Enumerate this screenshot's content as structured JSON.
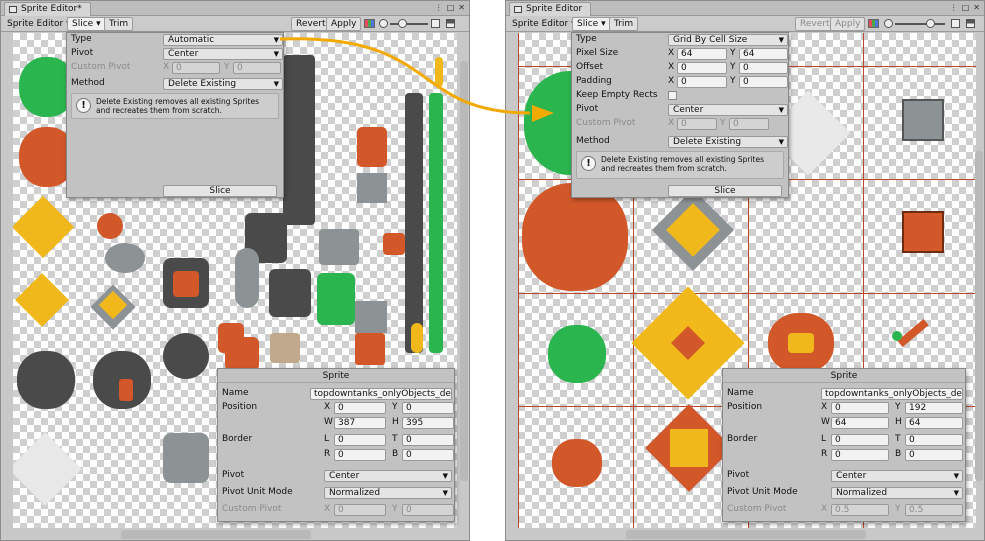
{
  "colors": {
    "window_bg": "#c8c8c8",
    "grid_line": "#b9482f",
    "arrow": "#f2a900",
    "sprite_green": "#2bb54f",
    "sprite_orange": "#d2582a",
    "sprite_yellow": "#f0b81b",
    "sprite_grey": "#8d9395"
  },
  "left": {
    "tab_title": "Sprite Editor*",
    "toolbar": {
      "mode": "Sprite Editor",
      "slice": "Slice",
      "trim": "Trim",
      "revert": "Revert",
      "apply": "Apply"
    },
    "slice_panel": {
      "type_label": "Type",
      "type_value": "Automatic",
      "pivot_label": "Pivot",
      "pivot_value": "Center",
      "custom_pivot_label": "Custom Pivot",
      "x_label": "X",
      "x_value": "0",
      "y_label": "Y",
      "y_value": "0",
      "method_label": "Method",
      "method_value": "Delete Existing",
      "help_text": "Delete Existing removes all existing Sprites and recreates them from scratch.",
      "slice_button": "Slice"
    },
    "sprite_panel": {
      "title": "Sprite",
      "name_label": "Name",
      "name_value": "topdowntanks_onlyObjects_de",
      "position_label": "Position",
      "x_label": "X",
      "x_value": "0",
      "y_label": "Y",
      "y_value": "0",
      "w_label": "W",
      "w_value": "387",
      "h_label": "H",
      "h_value": "395",
      "border_label": "Border",
      "l_label": "L",
      "l_value": "0",
      "t_label": "T",
      "t_value": "0",
      "r_label": "R",
      "r_value": "0",
      "b_label": "B",
      "b_value": "0",
      "pivot_label": "Pivot",
      "pivot_value": "Center",
      "pivot_unit_label": "Pivot Unit Mode",
      "pivot_unit_value": "Normalized",
      "custom_pivot_label": "Custom Pivot",
      "cx_value": "0",
      "cy_value": "0"
    }
  },
  "right": {
    "tab_title": "Sprite Editor",
    "toolbar": {
      "mode": "Sprite Editor",
      "slice": "Slice",
      "trim": "Trim",
      "revert": "Revert",
      "apply": "Apply"
    },
    "slice_panel": {
      "type_label": "Type",
      "type_value": "Grid By Cell Size",
      "pixel_size_label": "Pixel Size",
      "px_x": "64",
      "px_y": "64",
      "offset_label": "Offset",
      "off_x": "0",
      "off_y": "0",
      "padding_label": "Padding",
      "pad_x": "0",
      "pad_y": "0",
      "keep_empty_label": "Keep Empty Rects",
      "pivot_label": "Pivot",
      "pivot_value": "Center",
      "custom_pivot_label": "Custom Pivot",
      "cp_x": "0",
      "cp_y": "0",
      "method_label": "Method",
      "method_value": "Delete Existing",
      "help_text": "Delete Existing removes all existing Sprites and recreates them from scratch.",
      "slice_button": "Slice",
      "x_label": "X",
      "y_label": "Y"
    },
    "sprite_panel": {
      "title": "Sprite",
      "name_label": "Name",
      "name_value": "topdowntanks_onlyObjects_de",
      "position_label": "Position",
      "x_label": "X",
      "x_value": "0",
      "y_label": "Y",
      "y_value": "192",
      "w_label": "W",
      "w_value": "64",
      "h_label": "H",
      "h_value": "64",
      "border_label": "Border",
      "l_label": "L",
      "l_value": "0",
      "t_label": "T",
      "t_value": "0",
      "r_label": "R",
      "r_value": "0",
      "b_label": "B",
      "b_value": "0",
      "pivot_label": "Pivot",
      "pivot_value": "Center",
      "pivot_unit_label": "Pivot Unit Mode",
      "pivot_unit_value": "Normalized",
      "custom_pivot_label": "Custom Pivot",
      "cx_value": "0.5",
      "cy_value": "0.5"
    }
  }
}
